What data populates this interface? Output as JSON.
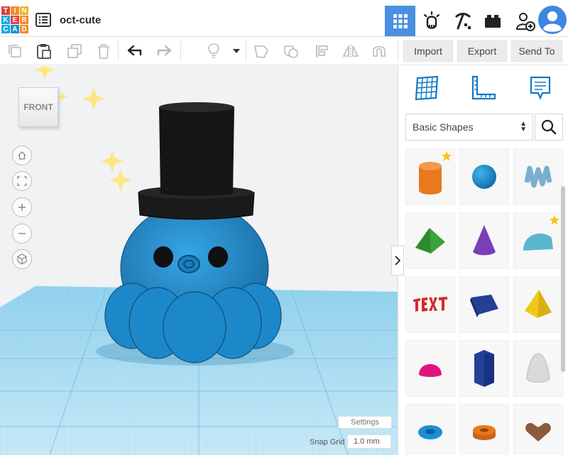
{
  "app": {
    "logo_letters": [
      "T",
      "I",
      "N",
      "K",
      "E",
      "R",
      "C",
      "A",
      "D"
    ],
    "logo_colors": [
      "#e0413c",
      "#f08d2b",
      "#f4b02c",
      "#1aa7e0",
      "#e0413c",
      "#f08d2b",
      "#1aa7e0",
      "#1c8fd6",
      "#f08d2b"
    ],
    "design_name": "oct-cute",
    "accent": "#4a8fe1"
  },
  "top_tools": [
    {
      "name": "3d-view-grid-icon",
      "active": true
    },
    {
      "name": "circuits-icon",
      "active": false
    },
    {
      "name": "codeblocks-pickaxe-icon",
      "active": false
    },
    {
      "name": "bricks-icon",
      "active": false
    },
    {
      "name": "add-user-icon",
      "active": false
    },
    {
      "name": "avatar-icon",
      "active": false
    }
  ],
  "toolbar": {
    "import_label": "Import",
    "export_label": "Export",
    "send_to_label": "Send To"
  },
  "workplane": {
    "viewcube_label": "FRONT",
    "settings_label": "Settings",
    "snap_grid_label": "Snap Grid",
    "snap_grid_value": "1.0 mm",
    "grid_color": "#7ec8e8",
    "model_body_color": "#1f8fd0",
    "hat_color": "#1a1a1a"
  },
  "panel": {
    "category": "Basic Shapes",
    "tools": [
      "workplane-icon",
      "ruler-icon",
      "notes-icon"
    ],
    "shapes": [
      {
        "name": "cylinder",
        "color": "#e8791c",
        "starred": true
      },
      {
        "name": "sphere",
        "color": "#1a8fd4",
        "starred": false
      },
      {
        "name": "scribble",
        "color": "#7aaecf",
        "starred": false
      },
      {
        "name": "roof",
        "color": "#3aa33a",
        "starred": false
      },
      {
        "name": "cone",
        "color": "#7a3fb8",
        "starred": false
      },
      {
        "name": "round-roof",
        "color": "#5ab6cc",
        "starred": true
      },
      {
        "name": "text",
        "color": "#d52b2b",
        "starred": false
      },
      {
        "name": "box-wedge",
        "color": "#233f96",
        "starred": false
      },
      {
        "name": "pyramid",
        "color": "#f0c81a",
        "starred": false
      },
      {
        "name": "half-sphere",
        "color": "#e0157e",
        "starred": false
      },
      {
        "name": "polygon",
        "color": "#233f96",
        "starred": false
      },
      {
        "name": "paraboloid",
        "color": "#d9d9d9",
        "starred": false
      },
      {
        "name": "torus",
        "color": "#1a8fd4",
        "starred": false
      },
      {
        "name": "tube",
        "color": "#e8791c",
        "starred": false
      },
      {
        "name": "heart",
        "color": "#8a5a3a",
        "starred": false
      }
    ]
  }
}
